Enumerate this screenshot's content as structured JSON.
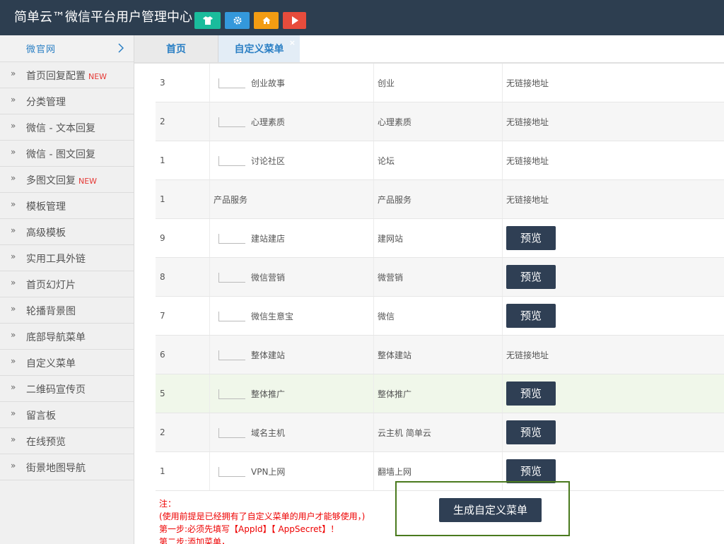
{
  "header": {
    "title": "简单云™微信平台用户管理中心",
    "buttons": [
      {
        "icon": "shirt-icon",
        "color": "#1abc9c"
      },
      {
        "icon": "gear-icon",
        "color": "#3498db"
      },
      {
        "icon": "home-icon",
        "color": "#f39c12"
      },
      {
        "icon": "play-icon",
        "color": "#e74c3c"
      }
    ]
  },
  "sidebar": {
    "top": {
      "label": "微官网"
    },
    "items": [
      {
        "label": "首页回复配置",
        "badge": "NEW"
      },
      {
        "label": "分类管理",
        "badge": ""
      },
      {
        "label": "微信 - 文本回复",
        "badge": ""
      },
      {
        "label": "微信 - 图文回复",
        "badge": ""
      },
      {
        "label": "多图文回复",
        "badge": "NEW"
      },
      {
        "label": "模板管理",
        "badge": ""
      },
      {
        "label": "高级模板",
        "badge": ""
      },
      {
        "label": "实用工具外链",
        "badge": ""
      },
      {
        "label": "首页幻灯片",
        "badge": ""
      },
      {
        "label": "轮播背景图",
        "badge": ""
      },
      {
        "label": "底部导航菜单",
        "badge": ""
      },
      {
        "label": "自定义菜单",
        "badge": ""
      },
      {
        "label": "二维码宣传页",
        "badge": ""
      },
      {
        "label": "留言板",
        "badge": ""
      },
      {
        "label": "在线预览",
        "badge": ""
      },
      {
        "label": "街景地图导航",
        "badge": ""
      }
    ]
  },
  "tabs": [
    {
      "label": "首页"
    },
    {
      "label": "自定义菜单",
      "close": "×"
    }
  ],
  "table": {
    "rows": [
      {
        "order": "3",
        "name": "创业故事",
        "child": true,
        "keyword": "创业",
        "url": "无链接地址",
        "preview": false
      },
      {
        "order": "2",
        "name": "心理素质",
        "child": true,
        "keyword": "心理素质",
        "url": "无链接地址",
        "preview": false
      },
      {
        "order": "1",
        "name": "讨论社区",
        "child": true,
        "keyword": "论坛",
        "url": "无链接地址",
        "preview": false
      },
      {
        "order": "1",
        "name": "产品服务",
        "child": false,
        "keyword": "产品服务",
        "url": "无链接地址",
        "preview": false
      },
      {
        "order": "9",
        "name": "建站建店",
        "child": true,
        "keyword": "建网站",
        "url": "",
        "preview": true
      },
      {
        "order": "8",
        "name": "微信营销",
        "child": true,
        "keyword": "微营销",
        "url": "",
        "preview": true
      },
      {
        "order": "7",
        "name": "微信生意宝",
        "child": true,
        "keyword": "微信",
        "url": "",
        "preview": true
      },
      {
        "order": "6",
        "name": "整体建站",
        "child": true,
        "keyword": "整体建站",
        "url": "无链接地址",
        "preview": false
      },
      {
        "order": "5",
        "name": "整体推广",
        "child": true,
        "keyword": "整体推广",
        "url": "",
        "preview": true,
        "highlight": true
      },
      {
        "order": "2",
        "name": "域名主机",
        "child": true,
        "keyword": "云主机 简单云",
        "url": "",
        "preview": true
      },
      {
        "order": "1",
        "name": "VPN上网",
        "child": true,
        "keyword": "翻墙上网",
        "url": "",
        "preview": true
      }
    ],
    "preview_label": "预览"
  },
  "notes": {
    "line1": "注：",
    "line2": "(使用前提是已经拥有了自定义菜单的用户才能够使用，)",
    "line3": "第一步:必须先填写【AppId】【 AppSecret】！",
    "line4": "第二步:添加菜单，"
  },
  "generate_button": {
    "label": "生成自定义菜单"
  }
}
